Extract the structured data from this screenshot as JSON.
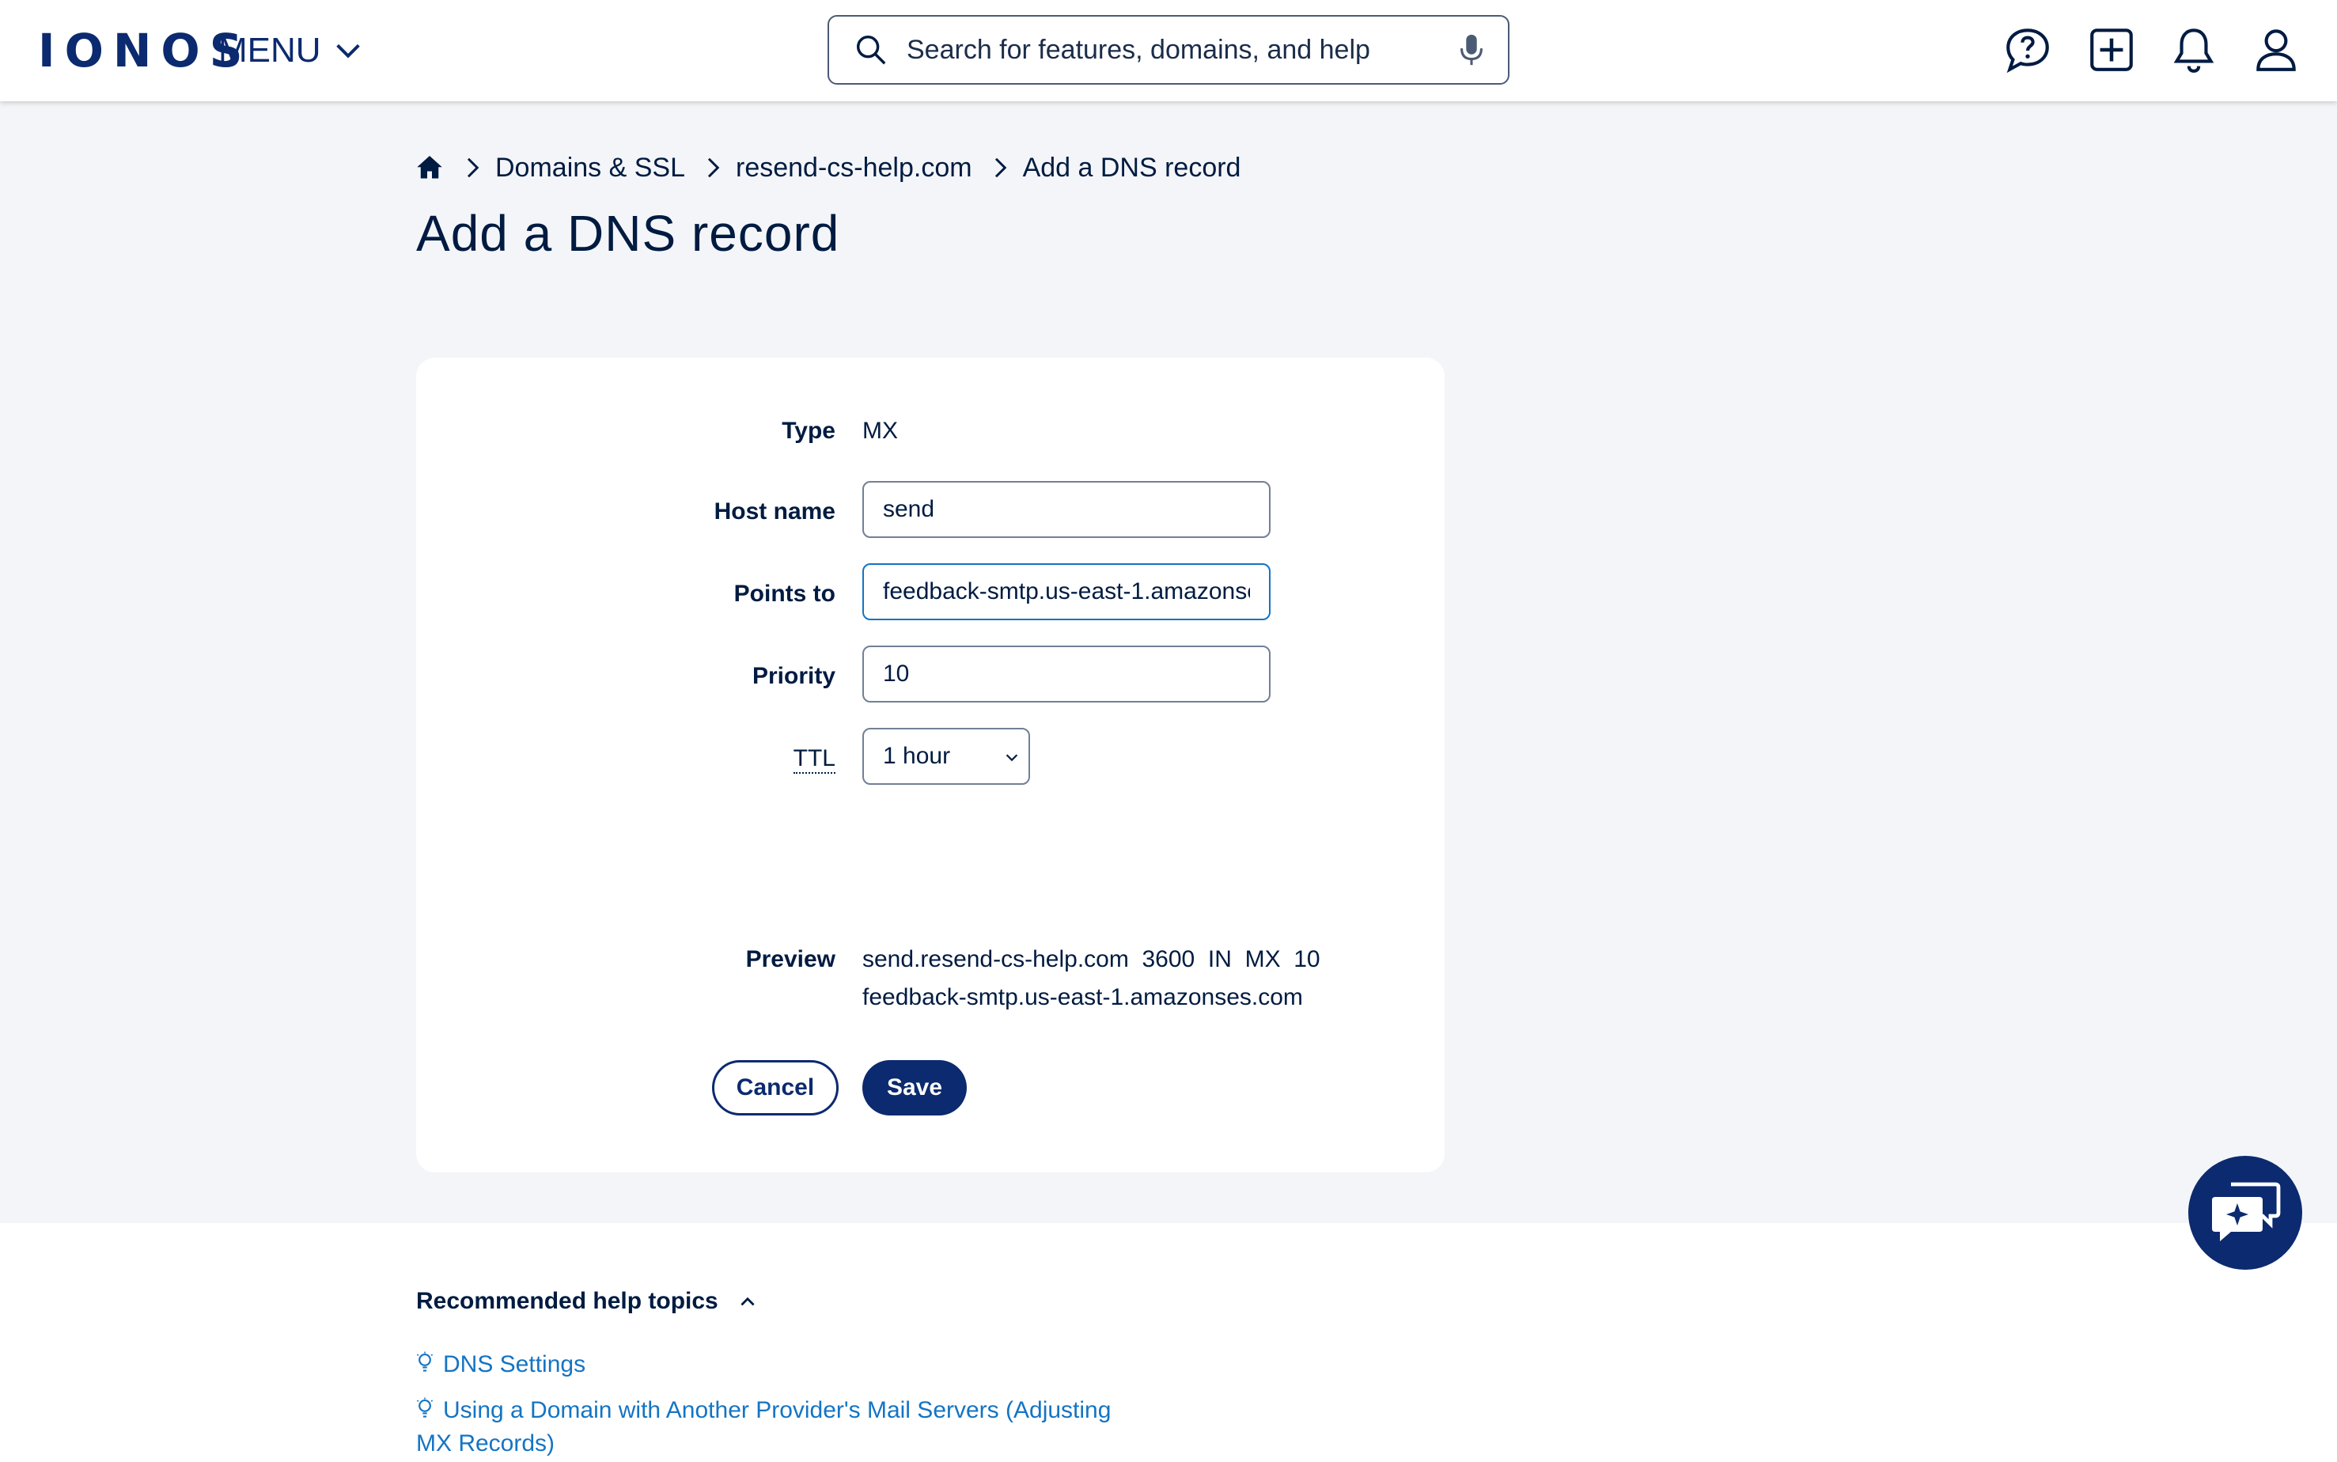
{
  "header": {
    "logo": "IONOS",
    "menu_label": "MENU",
    "search_placeholder": "Search for features, domains, and help",
    "icons": [
      "help-icon",
      "add-icon",
      "bell-icon",
      "user-icon"
    ]
  },
  "breadcrumb": {
    "items": [
      "Domains & SSL",
      "resend-cs-help.com",
      "Add a DNS record"
    ]
  },
  "page_title": "Add a DNS record",
  "form": {
    "type_label": "Type",
    "type_value": "MX",
    "host_label": "Host name",
    "host_value": "send",
    "points_label": "Points to",
    "points_value": "feedback-smtp.us-east-1.amazonses.com",
    "priority_label": "Priority",
    "priority_value": "10",
    "ttl_label": "TTL",
    "ttl_value": "1 hour",
    "preview_label": "Preview",
    "preview_line1": "send.resend-cs-help.com  3600  IN  MX  10",
    "preview_line2": "feedback-smtp.us-east-1.amazonses.com",
    "cancel_label": "Cancel",
    "save_label": "Save"
  },
  "help": {
    "title": "Recommended help topics",
    "links": [
      "DNS Settings",
      "Using a Domain with Another Provider's Mail Servers (Adjusting MX Records)"
    ]
  },
  "colors": {
    "brand": "#0b2a6f",
    "link": "#1474c4",
    "background": "#f4f5f8"
  }
}
